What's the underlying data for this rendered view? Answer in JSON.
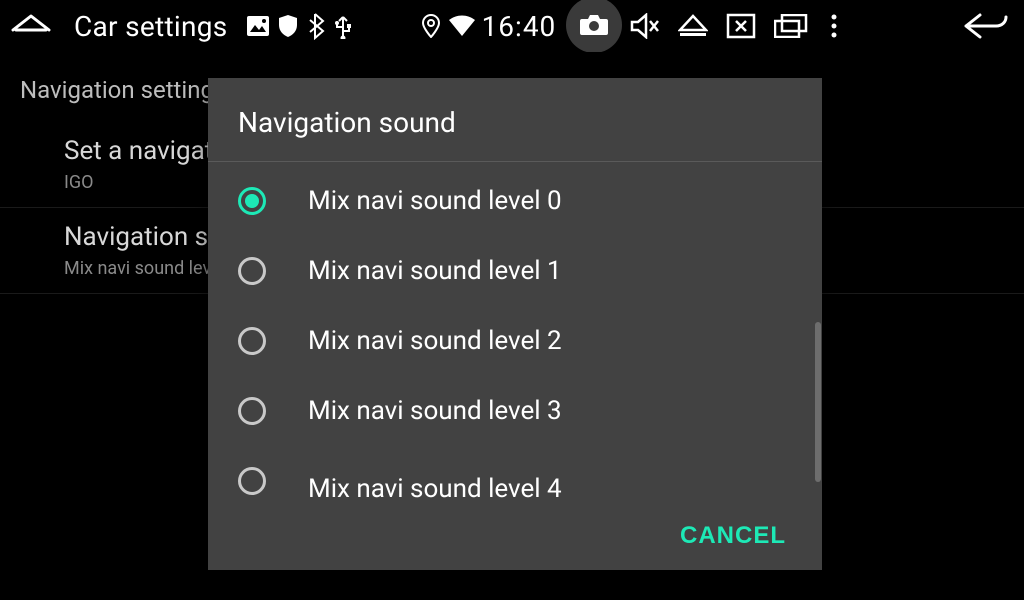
{
  "statusbar": {
    "app_title": "Car settings",
    "clock": "16:40"
  },
  "page": {
    "section_title": "Navigation settings",
    "items": [
      {
        "primary": "Set a navigati",
        "secondary": "IGO"
      },
      {
        "primary": "Navigation so",
        "secondary": "Mix navi sound lev"
      }
    ]
  },
  "dialog": {
    "title": "Navigation sound",
    "selected_index": 0,
    "options": [
      "Mix navi sound level 0",
      "Mix navi sound level 1",
      "Mix navi sound level 2",
      "Mix navi sound level 3",
      "Mix navi sound level 4"
    ],
    "cancel_label": "CANCEL"
  },
  "colors": {
    "accent": "#1de9b6"
  }
}
